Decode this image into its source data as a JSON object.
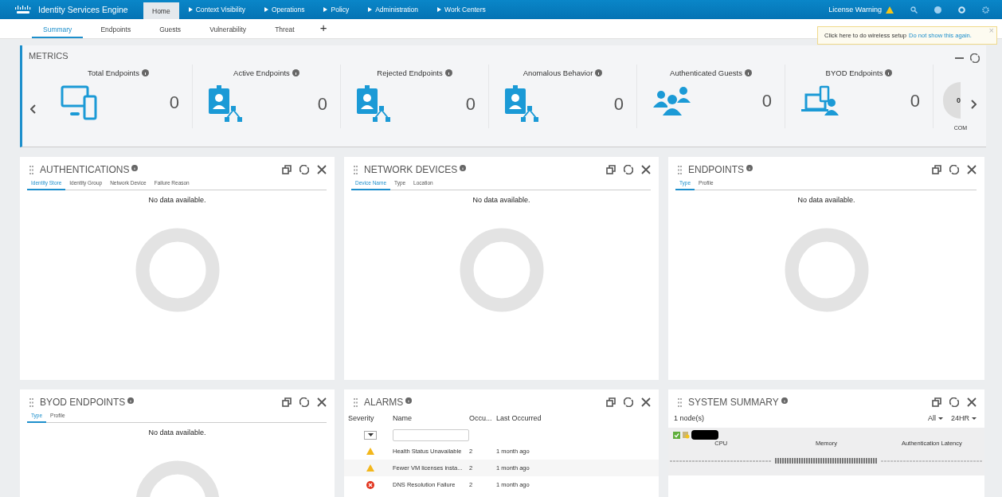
{
  "header": {
    "product": "Identity Services Engine",
    "tabs": [
      {
        "label": "Home",
        "selected": true,
        "menu": false
      },
      {
        "label": "Context Visibility",
        "selected": false,
        "menu": true
      },
      {
        "label": "Operations",
        "selected": false,
        "menu": true
      },
      {
        "label": "Policy",
        "selected": false,
        "menu": true
      },
      {
        "label": "Administration",
        "selected": false,
        "menu": true
      },
      {
        "label": "Work Centers",
        "selected": false,
        "menu": true
      }
    ],
    "license_warning": "License Warning"
  },
  "subtabs": [
    {
      "label": "Summary",
      "selected": true
    },
    {
      "label": "Endpoints",
      "selected": false
    },
    {
      "label": "Guests",
      "selected": false
    },
    {
      "label": "Vulnerability",
      "selected": false
    },
    {
      "label": "Threat",
      "selected": false
    }
  ],
  "add_tab": "+",
  "popup": {
    "text": "Click here to do wireless setup",
    "link": "Do not show this again.",
    "close": "×"
  },
  "metrics": {
    "title": "METRICS",
    "items": [
      {
        "title": "Total Endpoints",
        "kind": "devices",
        "value": "0"
      },
      {
        "title": "Active Endpoints",
        "kind": "badge",
        "value": "0"
      },
      {
        "title": "Rejected Endpoints",
        "kind": "badge",
        "value": "0"
      },
      {
        "title": "Anomalous Behavior",
        "kind": "badge",
        "value": "0"
      },
      {
        "title": "Authenticated Guests",
        "kind": "group",
        "value": "0"
      },
      {
        "title": "BYOD Endpoints",
        "kind": "byod",
        "value": "0"
      }
    ],
    "gauge": {
      "value": "0",
      "label": "COM"
    }
  },
  "dashlets": [
    {
      "kind": "donut",
      "title": "AUTHENTICATIONS",
      "tabs": [
        {
          "label": "Identity Store",
          "selected": true
        },
        {
          "label": "Identity Group",
          "selected": false
        },
        {
          "label": "Network Device",
          "selected": false
        },
        {
          "label": "Failure Reason",
          "selected": false
        }
      ],
      "empty": "No data available."
    },
    {
      "kind": "donut",
      "title": "NETWORK DEVICES",
      "tabs": [
        {
          "label": "Device Name",
          "selected": true
        },
        {
          "label": "Type",
          "selected": false
        },
        {
          "label": "Location",
          "selected": false
        }
      ],
      "empty": "No data available."
    },
    {
      "kind": "donut",
      "title": "ENDPOINTS",
      "tabs": [
        {
          "label": "Type",
          "selected": true
        },
        {
          "label": "Profile",
          "selected": false
        }
      ],
      "empty": "No data available."
    },
    {
      "kind": "donut",
      "title": "BYOD ENDPOINTS",
      "tabs": [
        {
          "label": "Type",
          "selected": true
        },
        {
          "label": "Profile",
          "selected": false
        }
      ],
      "empty": "No data available."
    },
    {
      "kind": "alarms",
      "title": "ALARMS",
      "columns": [
        "Severity",
        "Name",
        "Occu...",
        "Last Occurred"
      ],
      "rows": [
        {
          "kind": "warning",
          "name": "Health Status Unavailable",
          "count": "2",
          "last": "1 month ago"
        },
        {
          "kind": "warning",
          "name": "Fewer VM licenses insta...",
          "count": "2",
          "last": "1 month ago"
        },
        {
          "kind": "error",
          "name": "DNS Resolution Failure",
          "count": "2",
          "last": "1 month ago"
        }
      ]
    },
    {
      "kind": "system",
      "title": "SYSTEM SUMMARY",
      "nodes": "1 node(s)",
      "filters": [
        "All",
        "24HR"
      ],
      "node_ok": true,
      "columns": [
        "CPU",
        "Memory",
        "Authentication Latency"
      ]
    }
  ]
}
